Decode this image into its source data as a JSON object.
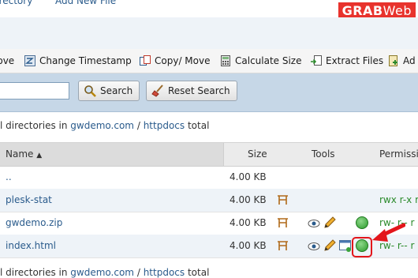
{
  "top_menu": {
    "directory": "Directory",
    "add_new_file": "Add New File"
  },
  "brand": {
    "grab": "GRAB",
    "web": "Web"
  },
  "toolbar": {
    "move": "Move",
    "change_timestamp": "Change Timestamp",
    "copy_move": "Copy/ Move",
    "calculate_size": "Calculate Size",
    "extract_files": "Extract Files",
    "add_partial": "Ad"
  },
  "search": {
    "placeholder": "",
    "search_label": "Search",
    "reset_label": "Reset Search"
  },
  "path": {
    "prefix": "l directories in",
    "domain": "gwdemo.com",
    "sep": "/",
    "folder": "httpdocs",
    "suffix": "total"
  },
  "table": {
    "headers": {
      "name": "Name",
      "size": "Size",
      "tools": "Tools",
      "permissions": "Permissi"
    },
    "rows": [
      {
        "name": "..",
        "size": "4.00 KB",
        "perm": ""
      },
      {
        "name": "plesk-stat",
        "size": "4.00 KB",
        "perm": "rwx r-x r"
      },
      {
        "name": "gwdemo.zip",
        "size": "4.00 KB",
        "perm": "rw- r-- r"
      },
      {
        "name": "index.html",
        "size": "4.00 KB",
        "perm": "rw- r-- r"
      }
    ]
  },
  "colors": {
    "link": "#2a5b8c",
    "brand": "#e8332d",
    "search_strip": "#c6d7e7",
    "callout": "#e3161b",
    "perm": "#2a8a2a"
  }
}
